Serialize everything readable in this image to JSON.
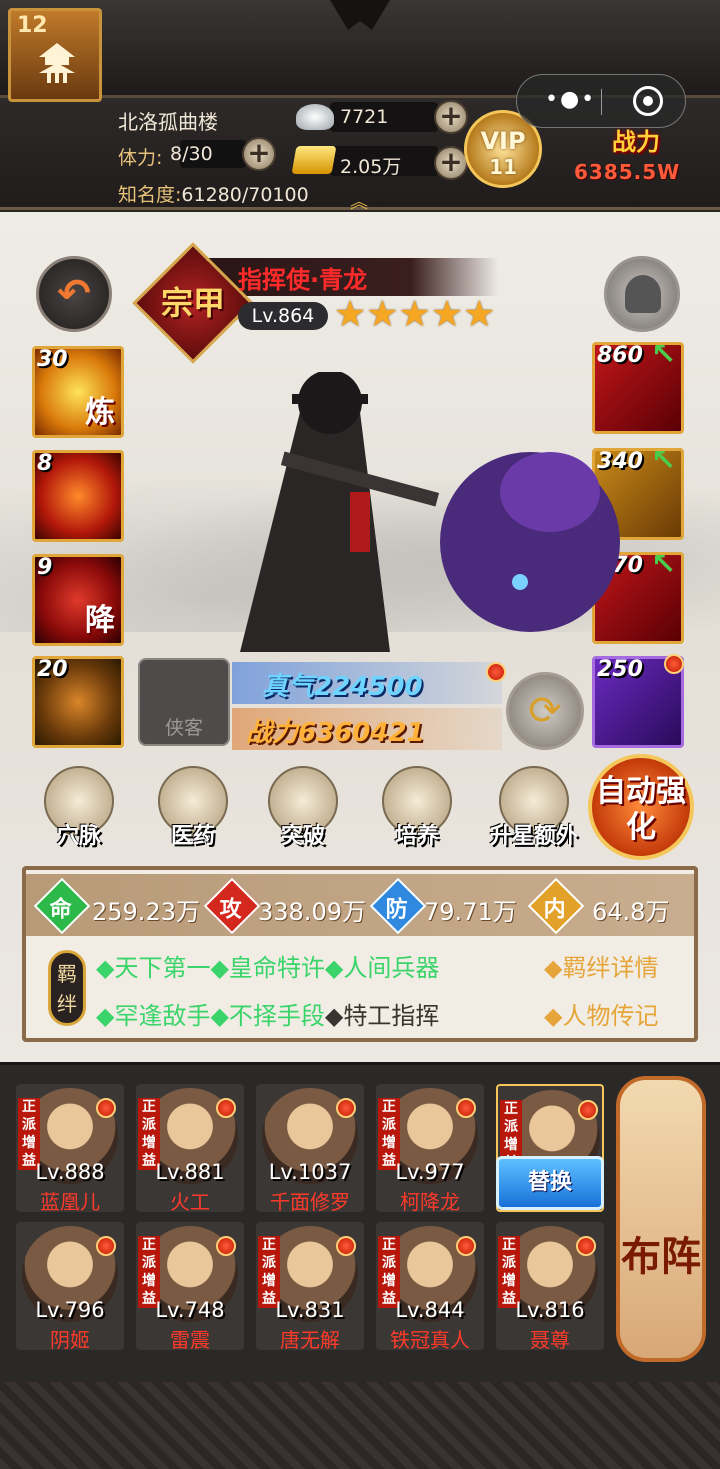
{
  "header": {
    "level": "12",
    "player_name": "北洛孤曲楼",
    "stamina_label": "体力:",
    "stamina_value": "8/30",
    "fame_label": "知名度:",
    "fame_value": "61280/70100",
    "silver": "7721",
    "gold": "2.05万",
    "vip_label": "VIP",
    "vip_level": "11",
    "power_label": "战力",
    "power_value": "6385.5W"
  },
  "hero": {
    "rank": "宗甲",
    "title": "指挥使·青龙",
    "level": "Lv.864",
    "stars": "★★★★★",
    "slot_label": "侠客",
    "zhenqi": "真气224500",
    "power": "战力6360421"
  },
  "skills": [
    {
      "num": "30",
      "glyph": "炼"
    },
    {
      "num": "8",
      "glyph": ""
    },
    {
      "num": "9",
      "glyph": "降"
    },
    {
      "num": "20",
      "glyph": ""
    }
  ],
  "equips": [
    {
      "num": "860"
    },
    {
      "num": "340"
    },
    {
      "num": "470"
    },
    {
      "num": "250"
    }
  ],
  "functions": [
    {
      "label": "穴脉"
    },
    {
      "label": "医药"
    },
    {
      "label": "突破"
    },
    {
      "label": "培养"
    },
    {
      "label": "升星额外"
    }
  ],
  "auto_strengthen": "自动强化",
  "stats": [
    {
      "icon": "命",
      "value": "259.23万",
      "color": "#2db84a"
    },
    {
      "icon": "攻",
      "value": "338.09万",
      "color": "#d4281e"
    },
    {
      "icon": "防",
      "value": "79.71万",
      "color": "#2f8adf"
    },
    {
      "icon": "内",
      "value": "64.8万",
      "color": "#e2a22a"
    }
  ],
  "bond": {
    "tag": "羁绊",
    "row1": "◆天下第一◆皇命特许◆人间兵器",
    "row2_green": "◆罕逢敌手◆不择手段",
    "row2_white": "◆特工指挥",
    "link1": "◆羁绊详情",
    "link2": "◆人物传记"
  },
  "roster": {
    "tag": "正派增益",
    "swap_label": "替换",
    "formation_label": "布阵",
    "cards": [
      {
        "lv": "Lv.888",
        "name": "蓝凰儿"
      },
      {
        "lv": "Lv.881",
        "name": "火工"
      },
      {
        "lv": "Lv.1037",
        "name": "千面修罗"
      },
      {
        "lv": "Lv.977",
        "name": "柯降龙"
      },
      {
        "lv": "",
        "name": ""
      },
      {
        "lv": "Lv.796",
        "name": "阴姬"
      },
      {
        "lv": "Lv.748",
        "name": "雷震"
      },
      {
        "lv": "Lv.831",
        "name": "唐无解"
      },
      {
        "lv": "Lv.844",
        "name": "铁冠真人"
      },
      {
        "lv": "Lv.816",
        "name": "聂尊"
      }
    ]
  }
}
